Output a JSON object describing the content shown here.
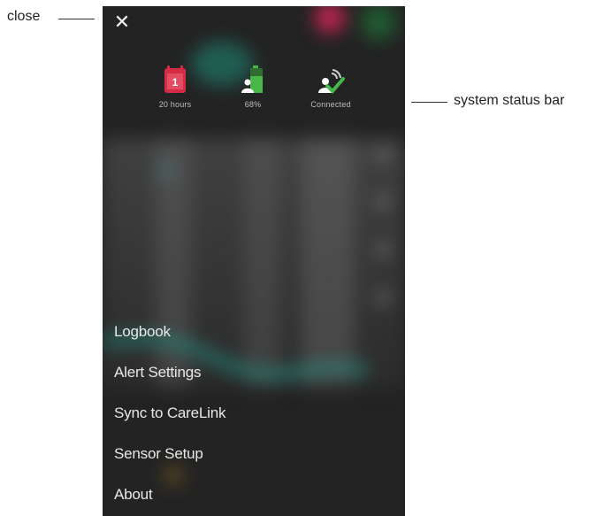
{
  "annotations": {
    "close": "close",
    "system_status_bar": "system status bar"
  },
  "close_button": {
    "glyph": "✕",
    "icon": "close-icon"
  },
  "status_bar": {
    "sensor": {
      "icon": "calendar-sensor-icon",
      "label": "20 hours",
      "color": "#d62b46"
    },
    "transmitter": {
      "icon": "battery-transmitter-icon",
      "label": "68%",
      "level": 0.68,
      "color": "#49b649"
    },
    "connection": {
      "icon": "connected-signal-icon",
      "label": "Connected",
      "color": "#49b649"
    }
  },
  "menu": {
    "items": [
      {
        "label": "Logbook"
      },
      {
        "label": "Alert Settings"
      },
      {
        "label": "Sync to CareLink"
      },
      {
        "label": "Sensor Setup"
      },
      {
        "label": "About"
      }
    ]
  },
  "colors": {
    "background": "#232323",
    "text": "#e8e8e8",
    "accent_teal": "#1f9c88"
  }
}
